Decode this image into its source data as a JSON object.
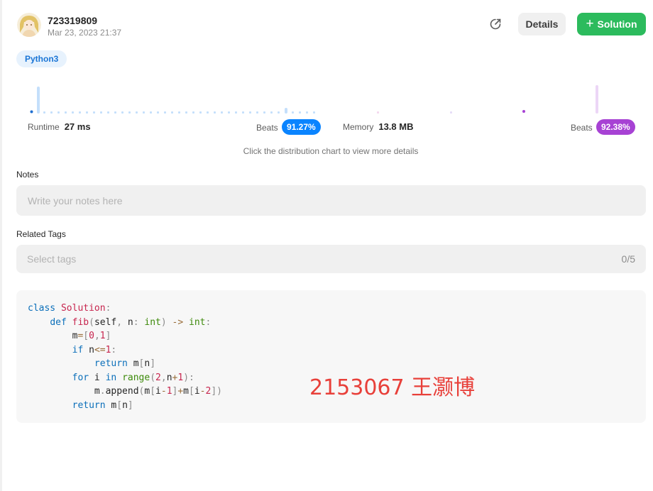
{
  "header": {
    "username": "723319809",
    "timestamp": "Mar 23, 2023 21:37",
    "details_label": "Details",
    "solution_label": "Solution",
    "solution_icon": "plus-icon",
    "share_icon": "share-icon"
  },
  "language": "Python3",
  "runtime": {
    "label": "Runtime",
    "value": "27 ms",
    "beats_label": "Beats",
    "beats": "91.27%",
    "color": "#0a84ff"
  },
  "memory": {
    "label": "Memory",
    "value": "13.8 MB",
    "beats_label": "Beats",
    "beats": "92.38%",
    "color": "#a742d4"
  },
  "chart_hint": "Click the distribution chart to view more details",
  "notes": {
    "label": "Notes",
    "placeholder": "Write your notes here"
  },
  "tags": {
    "label": "Related Tags",
    "placeholder": "Select tags",
    "count": "0/5"
  },
  "watermark": "2153067 王灏博"
}
